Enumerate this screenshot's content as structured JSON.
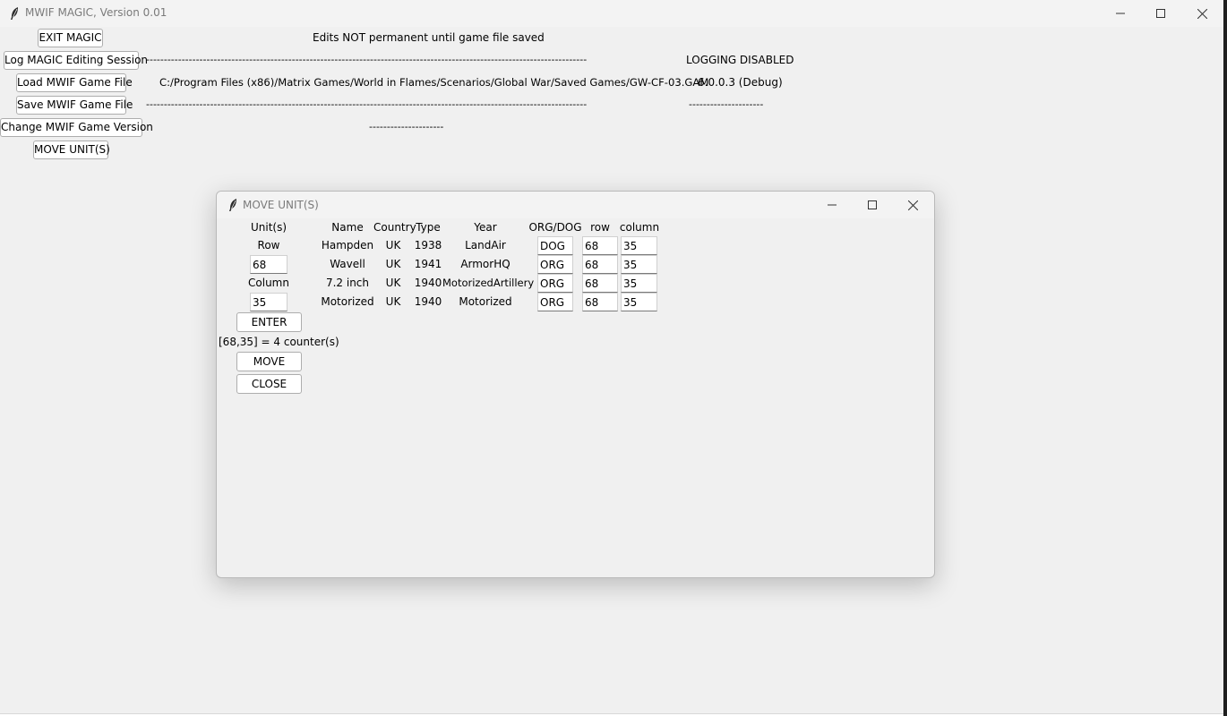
{
  "main": {
    "title": "MWIF MAGIC, Version 0.01",
    "buttons": {
      "exit": "EXIT MAGIC",
      "log": "Log MAGIC Editing Session",
      "load": "Load MWIF Game File",
      "save": "Save MWIF Game File",
      "change_version": "Change MWIF Game Version",
      "move_units": "MOVE UNIT(S)"
    },
    "notice": "Edits NOT permanent until game file saved",
    "log_dashes": "----------------------------------------------------------------------------------------------------------------------------",
    "logging_status": "LOGGING DISABLED",
    "file_path": "C:/Program Files (x86)/Matrix Games/World in Flames/Scenarios/Global War/Saved Games/GW-CF-03.GAM",
    "game_version": "6.0.0.3 (Debug)",
    "save_dashes": "----------------------------------------------------------------------------------------------------------------------------",
    "save_status": "---------------------",
    "version_dashes": "---------------------"
  },
  "dialog": {
    "title": "MOVE UNIT(S)",
    "units_label": "Unit(s)",
    "row_label": "Row",
    "row_value": "68",
    "column_label": "Column",
    "column_value": "35",
    "enter_button": "ENTER",
    "result": "[68,35] = 4 counter(s)",
    "move_button": "MOVE",
    "close_button": "CLOSE",
    "table": {
      "headers": [
        "Name",
        "Country",
        "Type",
        "Year",
        "ORG/DOG",
        "row",
        "column"
      ],
      "rows": [
        {
          "name": "Hampden",
          "country": "UK",
          "type": "1938",
          "year": "LandAir",
          "orgdog": "DOG",
          "row": "68",
          "column": "35"
        },
        {
          "name": "Wavell",
          "country": "UK",
          "type": "1941",
          "year": "ArmorHQ",
          "orgdog": "ORG",
          "row": "68",
          "column": "35"
        },
        {
          "name": "7.2 inch",
          "country": "UK",
          "type": "1940",
          "year": "MotorizedArtillery",
          "orgdog": "ORG",
          "row": "68",
          "column": "35"
        },
        {
          "name": "Motorized",
          "country": "UK",
          "type": "1940",
          "year": "Motorized",
          "orgdog": "ORG",
          "row": "68",
          "column": "35"
        }
      ]
    }
  },
  "icons": [
    "feather-icon",
    "minimize-icon",
    "maximize-icon",
    "close-icon"
  ]
}
